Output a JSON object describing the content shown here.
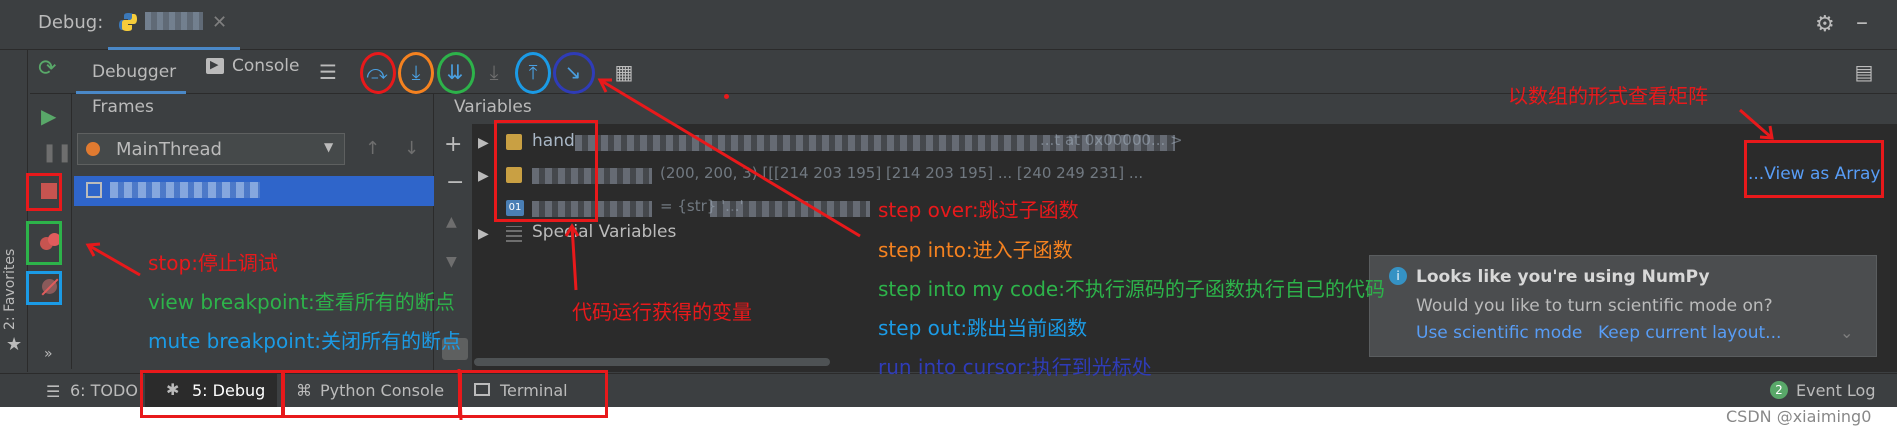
{
  "window": {
    "title": "Debug:",
    "tab_name": "█████"
  },
  "toolbar": {
    "tab_debugger": "Debugger",
    "tab_console": "Console",
    "icons": [
      "menu-icon",
      "step-over-icon",
      "step-into-icon",
      "step-into-my-code-icon",
      "force-step-into-icon",
      "step-out-icon",
      "run-to-cursor-icon",
      "evaluate-icon"
    ]
  },
  "frames": {
    "header": "Frames",
    "thread": "MainThread"
  },
  "variables": {
    "header": "Variables",
    "rows": [
      {
        "name": "hand",
        "value": "...t at 0x00000... >"
      },
      {
        "name": "",
        "value": "(200, 200, 3)  [[[214 203 195]  [214 203 195] ...  [240 249 231]  ...",
        "link": "...View as Array"
      },
      {
        "name": "",
        "value": "= {str} '...'"
      },
      {
        "name": "Special Variables",
        "value": ""
      }
    ]
  },
  "notification": {
    "title": "Looks like you're using NumPy",
    "body": "Would you like to turn scientific mode on?",
    "action1": "Use scientific mode",
    "action2": "Keep current layout..."
  },
  "bottom_tabs": {
    "todo": "6: TODO",
    "debug": "5: Debug",
    "python_console": "Python Console",
    "terminal": "Terminal",
    "event_log": "Event Log",
    "event_count": "2"
  },
  "sidebar": {
    "favorites": "2: Favorites"
  },
  "annotations": {
    "view_as_array": "以数组的形式查看矩阵",
    "stop": "stop:停止调试",
    "view_breakpoint": "view breakpoint:查看所有的断点",
    "mute_breakpoint": "mute breakpoint:关闭所有的断点",
    "variables_note": "代码运行获得的变量",
    "step_over": "step over:跳过子函数",
    "step_into": "step into:进入子函数",
    "step_into_my_code": "step into my code:不执行源码的子函数执行自己的代码",
    "step_out": "step out:跳出当前函数",
    "run_to_cursor": "run into cursor:执行到光标处"
  },
  "footer": {
    "watermark": "CSDN @xiaiming0"
  },
  "colors": {
    "red": "#e8191b",
    "orange": "#f58220",
    "green": "#2db34a",
    "blue": "#1b9be6",
    "navy": "#2f3cb8"
  }
}
